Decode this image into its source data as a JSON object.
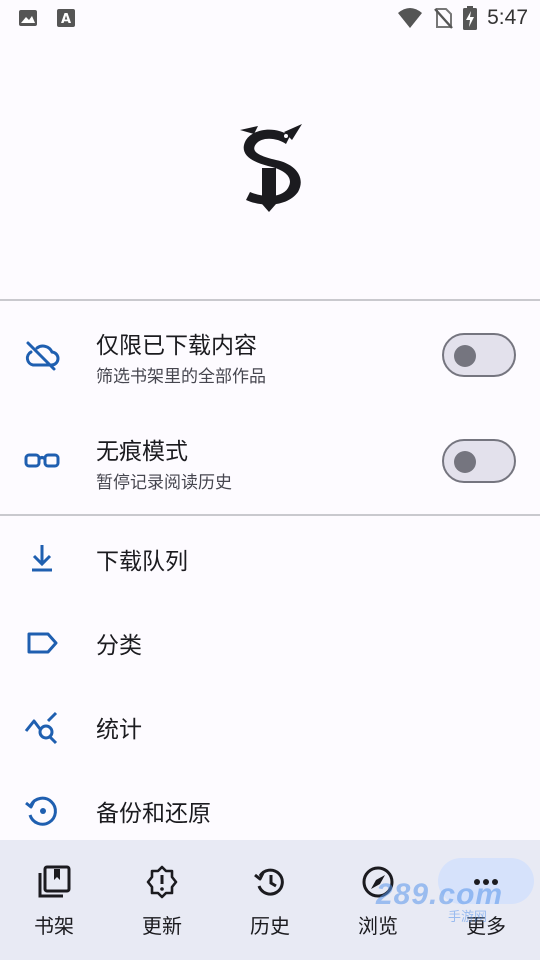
{
  "status_bar": {
    "time": "5:47",
    "icons": [
      "image-icon",
      "a-text-icon",
      "wifi-icon",
      "no-sim-icon",
      "battery-charging-icon"
    ]
  },
  "logo": {
    "icon": "snake-s-logo"
  },
  "toggles": [
    {
      "title": "仅限已下载内容",
      "subtitle": "筛选书架里的全部作品",
      "icon": "cloud-off-icon",
      "enabled": false
    },
    {
      "title": "无痕模式",
      "subtitle": "暂停记录阅读历史",
      "icon": "glasses-icon",
      "enabled": false
    }
  ],
  "menu": [
    {
      "label": "下载队列",
      "icon": "download-icon"
    },
    {
      "label": "分类",
      "icon": "label-icon"
    },
    {
      "label": "统计",
      "icon": "stats-search-icon"
    },
    {
      "label": "备份和还原",
      "icon": "restore-icon"
    }
  ],
  "bottom_nav": [
    {
      "label": "书架",
      "icon": "library-icon"
    },
    {
      "label": "更新",
      "icon": "alert-badge-icon"
    },
    {
      "label": "历史",
      "icon": "history-icon"
    },
    {
      "label": "浏览",
      "icon": "compass-icon"
    },
    {
      "label": "更多",
      "icon": "more-dots-icon",
      "selected": true
    }
  ],
  "watermark": {
    "text": "289.com",
    "subtext": "手游网"
  },
  "colors": {
    "accent": "#1f5fb0",
    "nav_bg": "#e8eaf4",
    "selected_pill": "#d6e2fb"
  }
}
